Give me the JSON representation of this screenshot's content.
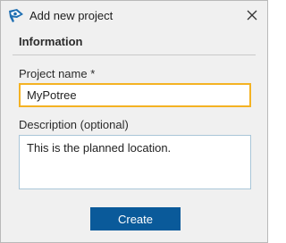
{
  "window": {
    "title": "Add new project",
    "icon": "potree-logo-icon",
    "close_icon": "close-icon"
  },
  "section": {
    "title": "Information"
  },
  "form": {
    "project_name_label": "Project name *",
    "project_name_value": "MyPotree",
    "description_label": "Description (optional)",
    "description_value": "This is the planned location."
  },
  "actions": {
    "create_label": "Create"
  },
  "colors": {
    "accent_focus_border": "#f4b223",
    "primary_button": "#0a5a9a",
    "description_border": "#a9c6d8",
    "app_icon_blue": "#1f6fb2"
  }
}
